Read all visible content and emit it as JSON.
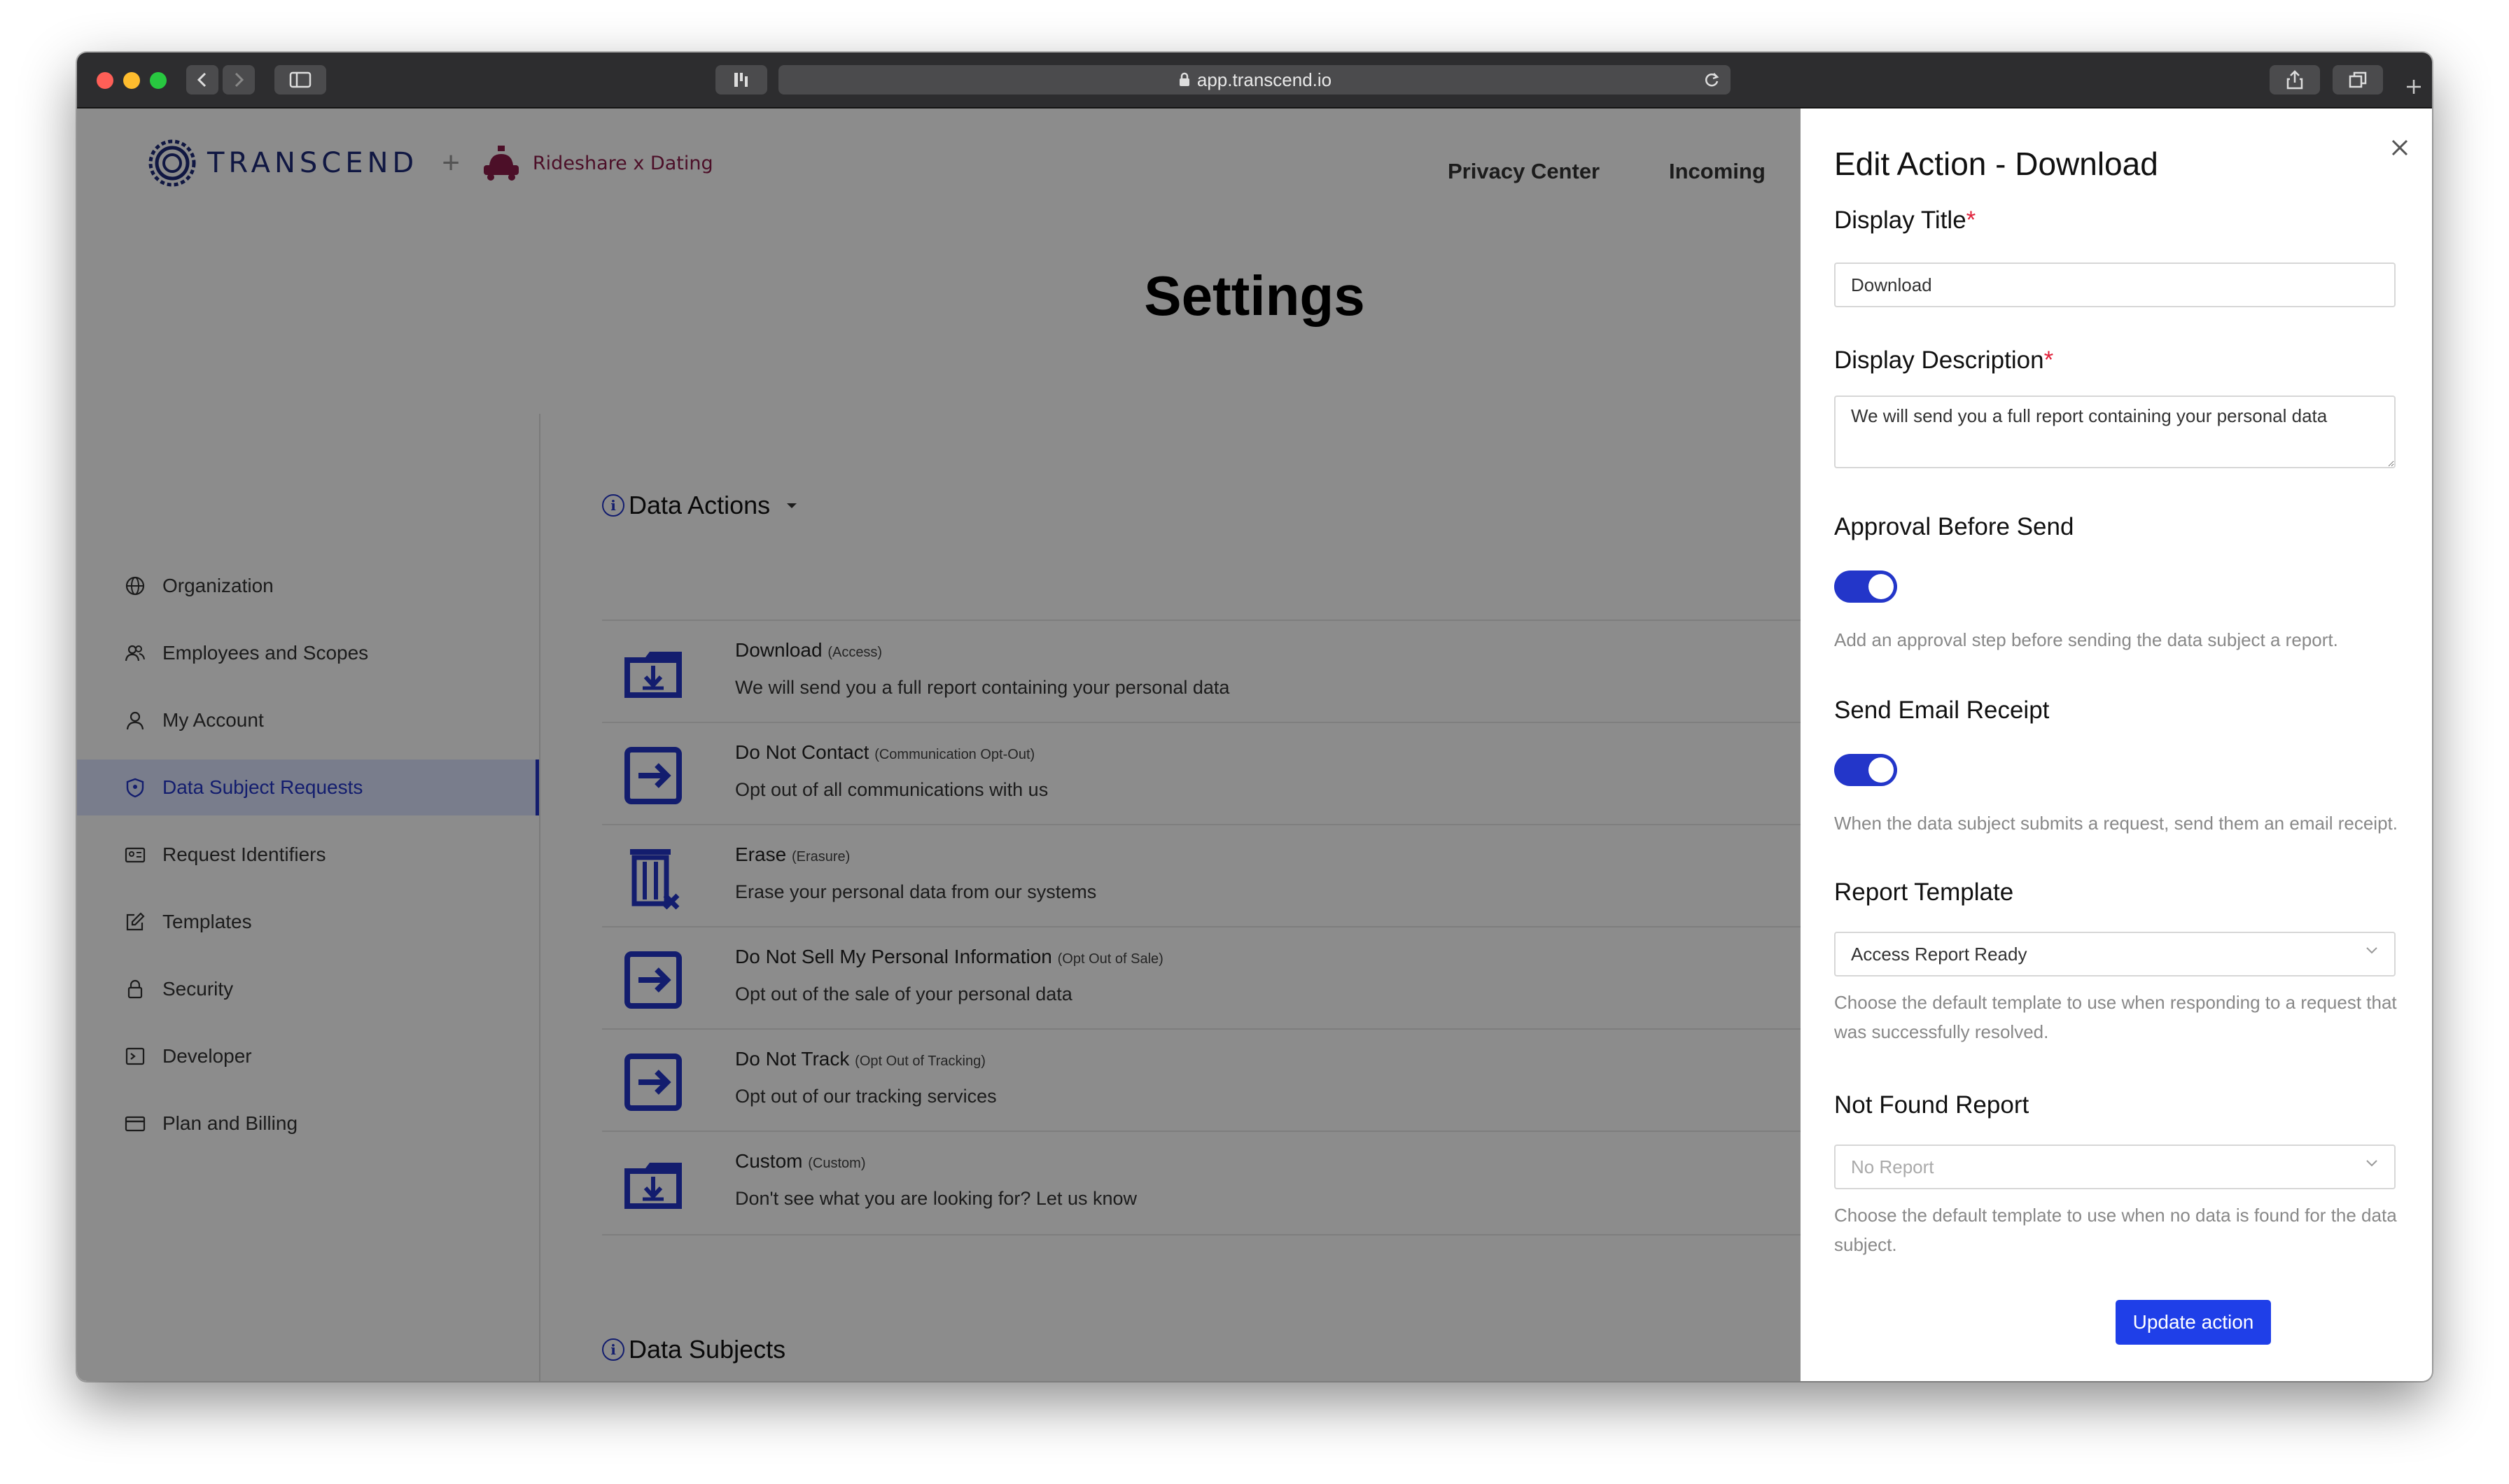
{
  "browser": {
    "url": "app.transcend.io"
  },
  "header": {
    "brand": "TRANSCEND",
    "separator": "+",
    "partner": "Rideshare x Dating",
    "nav": [
      "Privacy Center",
      "Incoming"
    ]
  },
  "page": {
    "title": "Settings"
  },
  "sidebar": {
    "items": [
      {
        "label": "Organization",
        "icon": "globe-icon"
      },
      {
        "label": "Employees and Scopes",
        "icon": "users-icon"
      },
      {
        "label": "My Account",
        "icon": "user-icon"
      },
      {
        "label": "Data Subject Requests",
        "icon": "shield-icon",
        "active": true
      },
      {
        "label": "Request Identifiers",
        "icon": "id-card-icon"
      },
      {
        "label": "Templates",
        "icon": "edit-icon"
      },
      {
        "label": "Security",
        "icon": "lock-icon"
      },
      {
        "label": "Developer",
        "icon": "terminal-icon"
      },
      {
        "label": "Plan and Billing",
        "icon": "credit-card-icon"
      }
    ]
  },
  "data_actions": {
    "heading": "Data Actions",
    "items": [
      {
        "name": "Download",
        "type": "(Access)",
        "description": "We will send you a full report containing your personal data",
        "icon": "folder-download-icon"
      },
      {
        "name": "Do Not Contact",
        "type": "(Communication Opt-Out)",
        "description": "Opt out of all communications with us",
        "icon": "opt-out-icon"
      },
      {
        "name": "Erase",
        "type": "(Erasure)",
        "description": "Erase your personal data from our systems",
        "icon": "trash-icon"
      },
      {
        "name": "Do Not Sell My Personal Information",
        "type": "(Opt Out of Sale)",
        "description": "Opt out of the sale of your personal data",
        "icon": "opt-out-icon"
      },
      {
        "name": "Do Not Track",
        "type": "(Opt Out of Tracking)",
        "description": "Opt out of our tracking services",
        "icon": "opt-out-icon"
      },
      {
        "name": "Custom",
        "type": "(Custom)",
        "description": "Don't see what you are looking for? Let us know",
        "icon": "folder-download-icon"
      }
    ]
  },
  "data_subjects": {
    "heading": "Data Subjects"
  },
  "panel": {
    "title": "Edit Action - Download",
    "display_title_label": "Display Title",
    "display_title_value": "Download",
    "display_description_label": "Display Description",
    "display_description_value": "We will send you a full report containing your personal data",
    "required_mark": "*",
    "approval_label": "Approval Before Send",
    "approval_on": true,
    "approval_help": "Add an approval step before sending the data subject a report.",
    "email_receipt_label": "Send Email Receipt",
    "email_receipt_on": true,
    "email_receipt_help": "When the data subject submits a request, send them an email receipt.",
    "report_template_label": "Report Template",
    "report_template_value": "Access Report Ready",
    "report_template_help": "Choose the default template to use when responding to a request that was successfully resolved.",
    "not_found_label": "Not Found Report",
    "not_found_placeholder": "No Report",
    "not_found_help": "Choose the default template to use when no data is found for the data subject.",
    "update_button": "Update action"
  },
  "colors": {
    "accent": "#2336c9",
    "button": "#1f3fe8",
    "partner": "#8b1c4a",
    "required": "#e0223b"
  }
}
